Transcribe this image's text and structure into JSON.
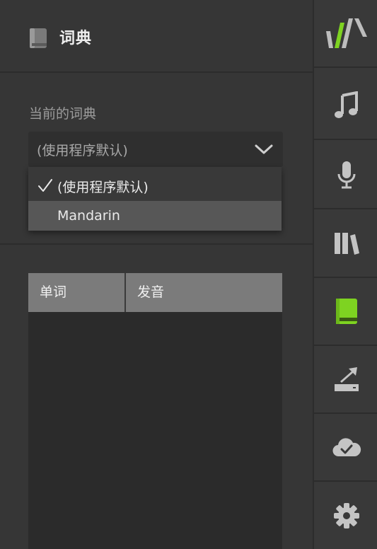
{
  "header": {
    "title": "词典",
    "icon": "book-icon"
  },
  "dictionary": {
    "label": "当前的词典",
    "selected": "(使用程序默认)",
    "options": [
      {
        "label": "(使用程序默认)",
        "checked": true
      },
      {
        "label": "Mandarin",
        "checked": false,
        "highlighted": true
      }
    ]
  },
  "table": {
    "columns": [
      "单词",
      "发音"
    ],
    "rows": []
  },
  "sidebar": {
    "items": [
      {
        "name": "logo",
        "icon": "app-logo-icon"
      },
      {
        "name": "music",
        "icon": "music-note-icon"
      },
      {
        "name": "voice",
        "icon": "microphone-icon"
      },
      {
        "name": "library",
        "icon": "library-icon"
      },
      {
        "name": "dictionary",
        "icon": "book-icon",
        "active": true
      },
      {
        "name": "export",
        "icon": "export-icon"
      },
      {
        "name": "cloud",
        "icon": "cloud-check-icon"
      },
      {
        "name": "settings",
        "icon": "gear-icon"
      }
    ]
  },
  "colors": {
    "accent": "#7ed321",
    "icon": "#c4c4c4",
    "background": "#363636"
  }
}
